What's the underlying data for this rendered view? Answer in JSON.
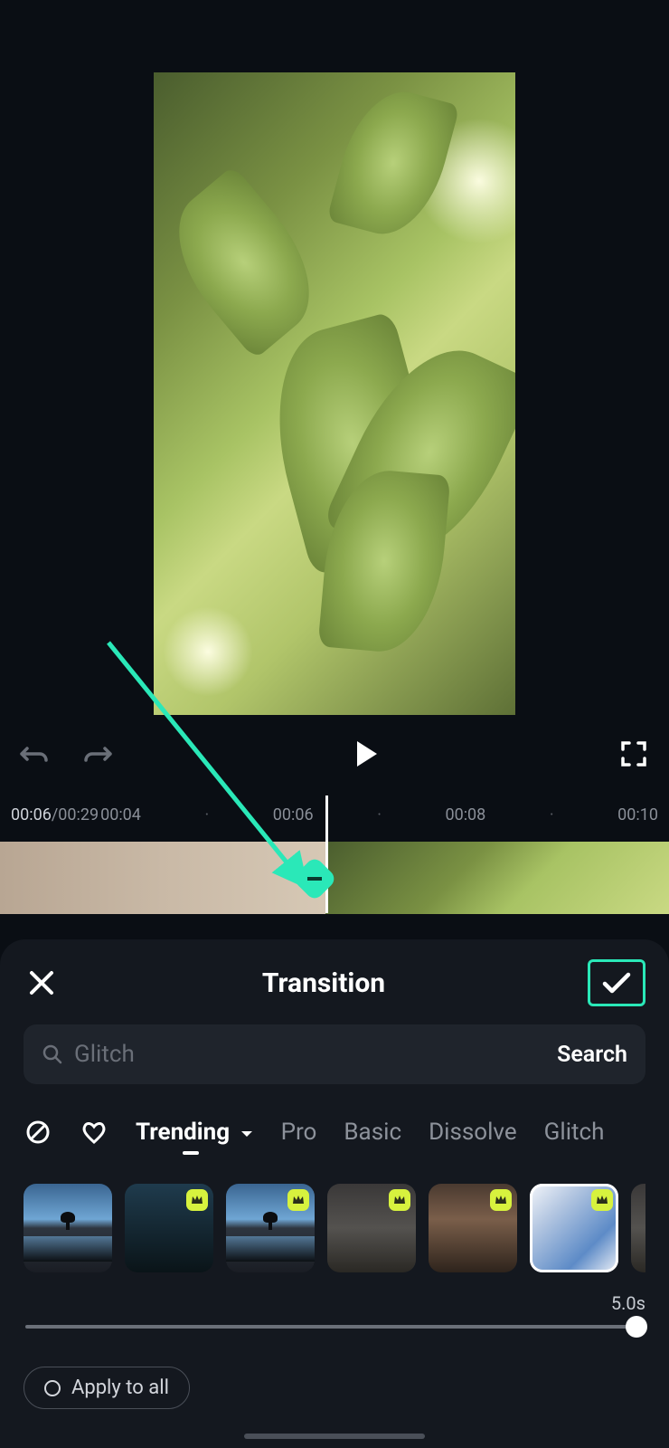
{
  "timebar": {
    "current": "00:06",
    "total": "00:29",
    "marks": [
      "00:04",
      "00:06",
      "00:08",
      "00:10"
    ]
  },
  "panel": {
    "title": "Transition",
    "search_placeholder": "Glitch",
    "search_button": "Search",
    "tabs": [
      "Trending",
      "Pro",
      "Basic",
      "Dissolve",
      "Glitch"
    ],
    "slider_value": "5.0s",
    "apply_all": "Apply to all"
  }
}
